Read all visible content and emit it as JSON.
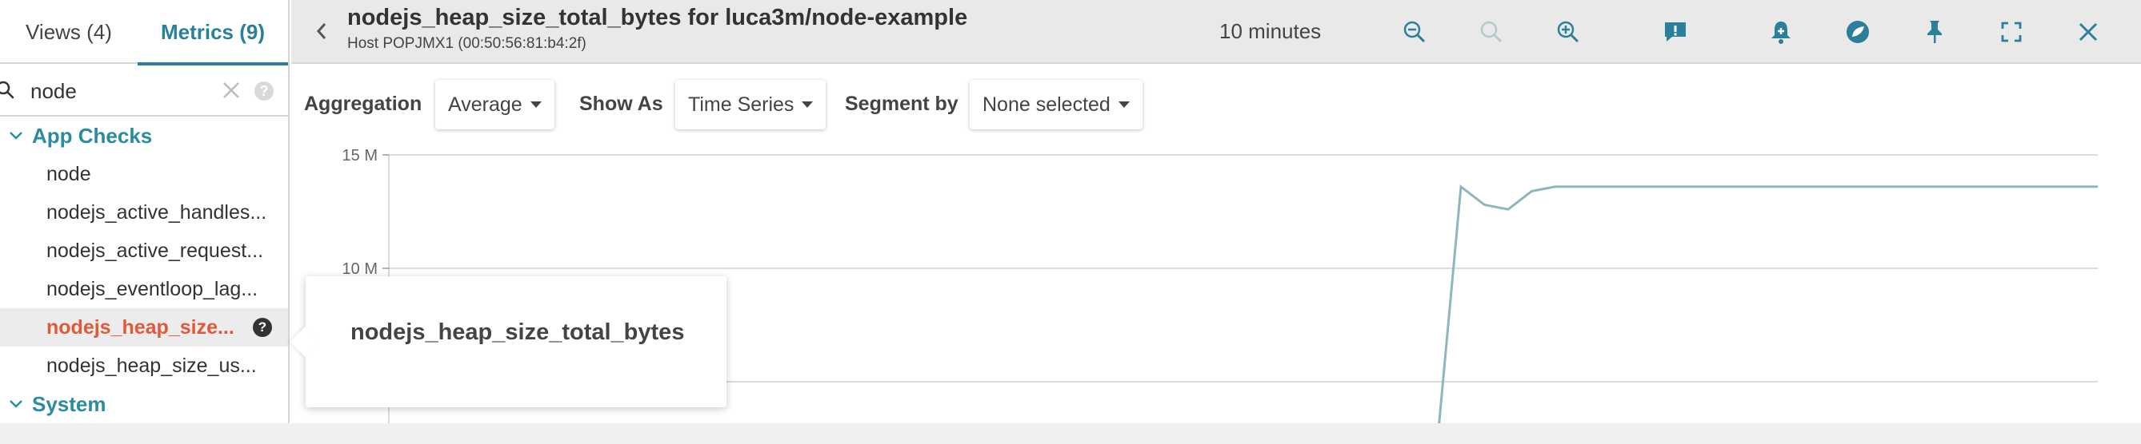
{
  "sidebar": {
    "tabs": [
      {
        "label": "Views (4)"
      },
      {
        "label": "Metrics (9)"
      }
    ],
    "search": {
      "value": "node",
      "placeholder": ""
    },
    "groups": [
      {
        "label": "App Checks",
        "items": [
          {
            "label": "node"
          },
          {
            "label": "nodejs_active_handles..."
          },
          {
            "label": "nodejs_active_request..."
          },
          {
            "label": "nodejs_eventloop_lag..."
          },
          {
            "label": "nodejs_heap_size..."
          },
          {
            "label": "nodejs_heap_size_us..."
          }
        ]
      },
      {
        "label": "System"
      }
    ]
  },
  "header": {
    "title": "nodejs_heap_size_total_bytes for luca3m/node-example",
    "subtitle": "Host POPJMX1 (00:50:56:81:b4:2f)",
    "time_range": "10 minutes",
    "icons": [
      "back-icon",
      "zoom-out-icon",
      "zoom-reset-icon",
      "zoom-in-icon",
      "comment-icon",
      "alert-bell-icon",
      "explore-icon",
      "pin-icon",
      "fullscreen-icon",
      "close-icon"
    ]
  },
  "controls": {
    "aggregation_label": "Aggregation",
    "aggregation_value": "Average",
    "show_as_label": "Show As",
    "show_as_value": "Time Series",
    "segment_label": "Segment by",
    "segment_value": "None selected"
  },
  "tooltip": {
    "text": "nodejs_heap_size_total_bytes"
  },
  "colors": {
    "accent": "#2a7f9b",
    "active_item": "#e05a3a",
    "series": "#8fb6bb"
  },
  "chart_data": {
    "type": "line",
    "y_tick_labels": [
      "15 M",
      "10 M"
    ],
    "ylim": [
      0,
      15000000
    ],
    "grid": true,
    "series": [
      {
        "values": [
          0,
          0,
          0,
          0,
          0,
          0,
          0,
          0,
          0,
          0,
          0,
          0,
          0,
          0,
          0,
          0,
          0,
          0,
          13600000,
          12800000,
          12600000,
          13400000,
          13600000,
          13600000,
          13600000,
          13600000,
          13600000,
          13600000,
          13600000,
          13600000,
          13600000,
          13600000,
          13600000,
          13600000,
          13600000,
          13600000,
          13600000,
          13600000,
          13600000,
          13600000,
          13600000,
          13600000,
          13600000,
          13600000,
          13600000,
          13600000
        ]
      }
    ]
  }
}
